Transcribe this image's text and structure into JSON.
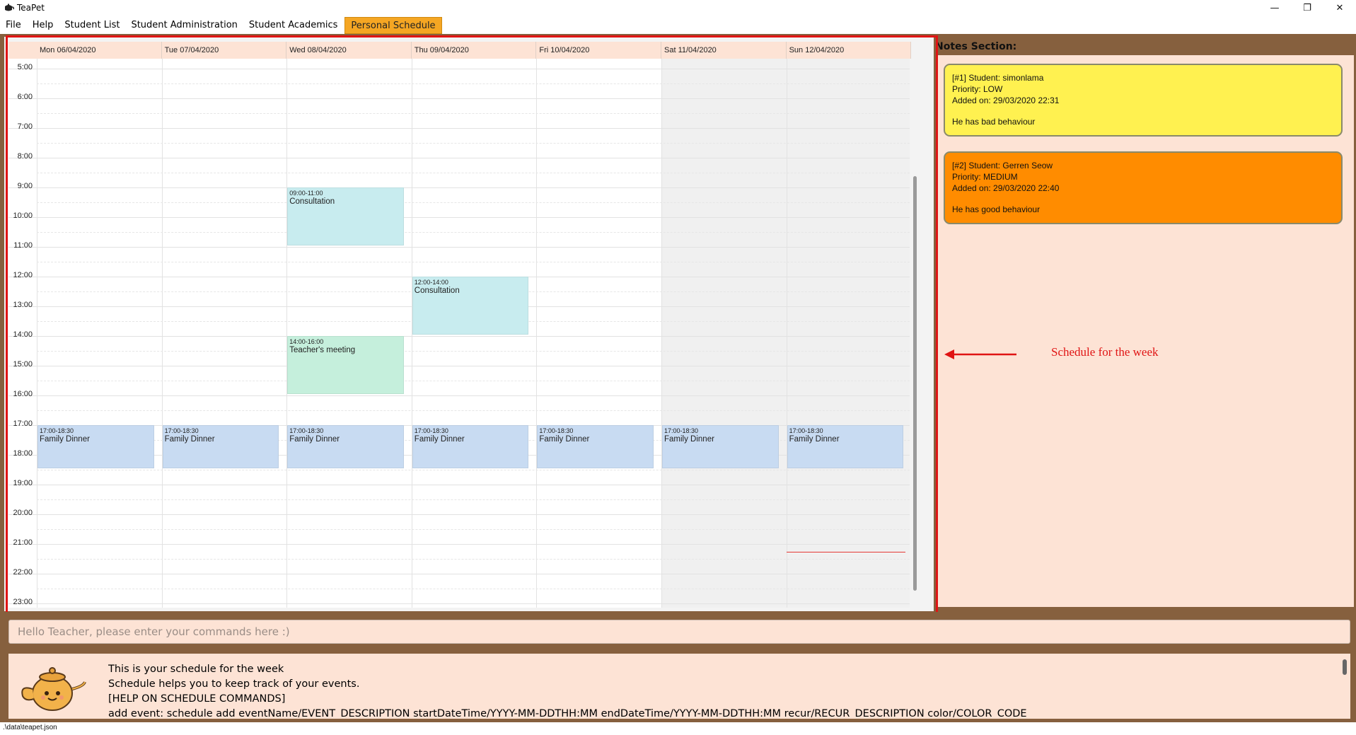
{
  "window": {
    "title": "TeaPet",
    "controls": [
      "minimize",
      "restore",
      "close"
    ]
  },
  "menu": {
    "items": [
      "File",
      "Help",
      "Student List",
      "Student Administration",
      "Student Academics",
      "Personal Schedule"
    ],
    "active": "Personal Schedule"
  },
  "schedule": {
    "days": [
      "Mon 06/04/2020",
      "Tue 07/04/2020",
      "Wed 08/04/2020",
      "Thu 09/04/2020",
      "Fri 10/04/2020",
      "Sat 11/04/2020",
      "Sun 12/04/2020"
    ],
    "weekend_days": [
      5,
      6
    ],
    "hours": [
      "5:00",
      "6:00",
      "7:00",
      "8:00",
      "9:00",
      "10:00",
      "11:00",
      "12:00",
      "13:00",
      "14:00",
      "15:00",
      "16:00",
      "17:00",
      "18:00",
      "19:00",
      "20:00",
      "21:00",
      "22:00",
      "23:00"
    ],
    "first_hour": 5,
    "events": [
      {
        "day": 2,
        "start": 9,
        "end": 11,
        "time": "09:00-11:00",
        "name": "Consultation",
        "color": "#c8ecef"
      },
      {
        "day": 3,
        "start": 12,
        "end": 14,
        "time": "12:00-14:00",
        "name": "Consultation",
        "color": "#c8ecef"
      },
      {
        "day": 2,
        "start": 14,
        "end": 16,
        "time": "14:00-16:00",
        "name": "Teacher's meeting",
        "color": "#c5efdc"
      },
      {
        "day": 0,
        "start": 17,
        "end": 18.5,
        "time": "17:00-18:30",
        "name": "Family Dinner",
        "color": "#c8dbf2"
      },
      {
        "day": 1,
        "start": 17,
        "end": 18.5,
        "time": "17:00-18:30",
        "name": "Family Dinner",
        "color": "#c8dbf2"
      },
      {
        "day": 2,
        "start": 17,
        "end": 18.5,
        "time": "17:00-18:30",
        "name": "Family Dinner",
        "color": "#c8dbf2"
      },
      {
        "day": 3,
        "start": 17,
        "end": 18.5,
        "time": "17:00-18:30",
        "name": "Family Dinner",
        "color": "#c8dbf2"
      },
      {
        "day": 4,
        "start": 17,
        "end": 18.5,
        "time": "17:00-18:30",
        "name": "Family Dinner",
        "color": "#c8dbf2"
      },
      {
        "day": 5,
        "start": 17,
        "end": 18.5,
        "time": "17:00-18:30",
        "name": "Family Dinner",
        "color": "#c8dbf2"
      },
      {
        "day": 6,
        "start": 17,
        "end": 18.5,
        "time": "17:00-18:30",
        "name": "Family Dinner",
        "color": "#c8dbf2"
      }
    ],
    "now_indicator": {
      "day": 6,
      "hour": 21.25,
      "color": "#e53935"
    }
  },
  "annotation": {
    "text": "Schedule for the week",
    "color": "#e01414"
  },
  "notes": {
    "title": "Notes Section:",
    "cards": [
      {
        "header": "[#1] Student: simonlama",
        "priority": "Priority: LOW",
        "added": "Added on: 29/03/2020 22:31",
        "desc": "He has bad behaviour",
        "color": "#fff150"
      },
      {
        "header": "[#2] Student: Gerren Seow",
        "priority": "Priority: MEDIUM",
        "added": "Added on: 29/03/2020 22:40",
        "desc": "He has good behaviour",
        "color": "#ff8c00"
      }
    ]
  },
  "command": {
    "placeholder": "Hello Teacher, please enter your commands here :)"
  },
  "result": {
    "lines": [
      "This is your schedule for the week",
      "Schedule helps you to keep track of your events.",
      "[HELP ON SCHEDULE COMMANDS]",
      "add event: schedule add eventName/EVENT_DESCRIPTION startDateTime/YYYY-MM-DDTHH:MM endDateTime/YYYY-MM-DDTHH:MM recur/RECUR_DESCRIPTION color/COLOR_CODE"
    ]
  },
  "status": {
    "path": ".\\data\\teapet.json"
  }
}
